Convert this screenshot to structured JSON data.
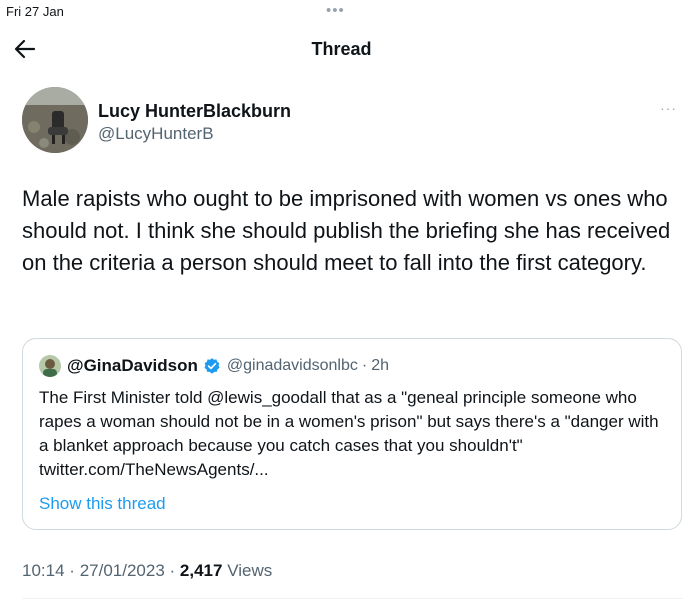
{
  "status_bar": {
    "time": "Fri 27 Jan",
    "dots": "•••"
  },
  "nav": {
    "title": "Thread",
    "back_icon": "arrow-left-icon"
  },
  "tweet": {
    "author_name": "Lucy HunterBlackburn",
    "author_handle": "@LucyHunterB",
    "more_label": "···",
    "text": "Male rapists who ought to be imprisoned with women vs ones who should not. I think she should publish the briefing she has received on the criteria a person should meet to fall into the first category.",
    "time": "10:14",
    "date": "27/01/2023",
    "separator": "·",
    "views_count": "2,417",
    "views_label": "Views"
  },
  "quoted_tweet": {
    "author_name": "@GinaDavidson",
    "author_handle": "@ginadavidsonlbc",
    "separator": "·",
    "time_ago": "2h",
    "verified_icon": "verified-badge-icon",
    "text": "The First Minister told @lewis_goodall that as a \"geneal principle someone who rapes a woman should not be in a women's prison\" but says there's a \"danger with a blanket approach because you catch cases that you shouldn't\" twitter.com/TheNewsAgents/...",
    "show_thread_label": "Show this thread"
  },
  "colors": {
    "text_primary": "#0f1419",
    "text_secondary": "#536471",
    "link": "#1d9bf0",
    "border": "#cfd9de",
    "verified": "#1d9bf0"
  }
}
